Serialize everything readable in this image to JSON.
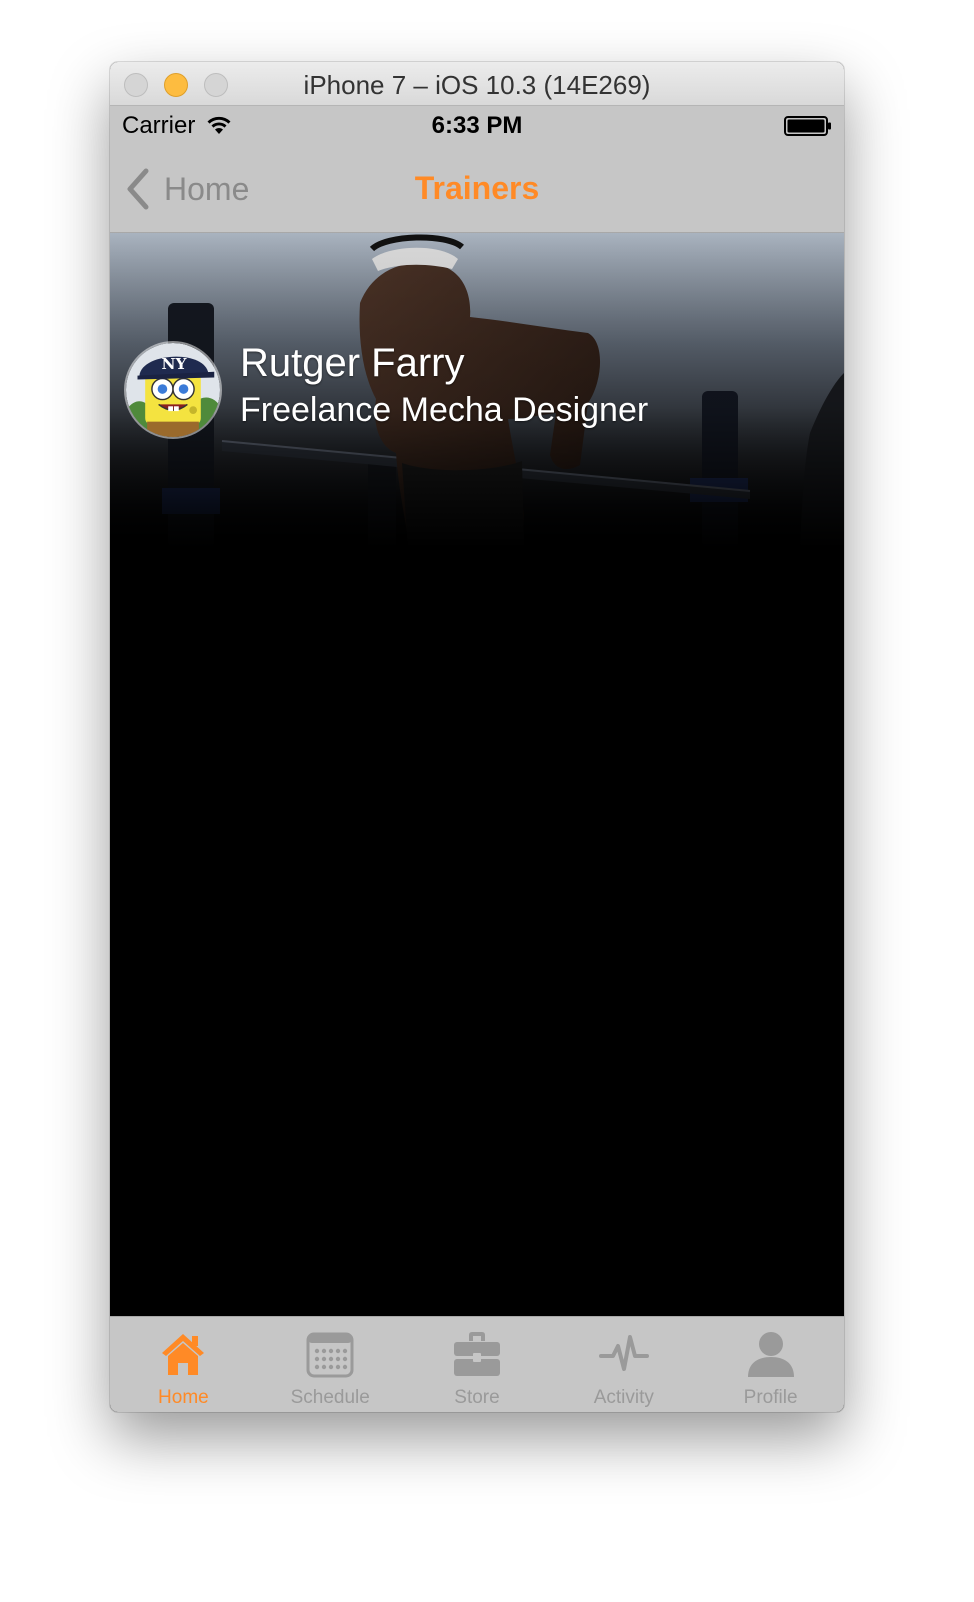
{
  "window": {
    "title": "iPhone 7 – iOS 10.3 (14E269)"
  },
  "status_bar": {
    "carrier": "Carrier",
    "time": "6:33 PM"
  },
  "nav_bar": {
    "back_label": "Home",
    "title": "Trainers"
  },
  "trainer": {
    "name": "Rutger Farry",
    "role": "Freelance Mecha Designer"
  },
  "tab_bar": {
    "items": [
      {
        "label": "Home",
        "icon": "home-icon",
        "active": true
      },
      {
        "label": "Schedule",
        "icon": "calendar-icon",
        "active": false
      },
      {
        "label": "Store",
        "icon": "briefcase-icon",
        "active": false
      },
      {
        "label": "Activity",
        "icon": "pulse-icon",
        "active": false
      },
      {
        "label": "Profile",
        "icon": "person-icon",
        "active": false
      }
    ]
  },
  "colors": {
    "accent": "#ff8a26",
    "bar_background": "#c6c6c6",
    "inactive_tab": "#9a9a9a"
  }
}
